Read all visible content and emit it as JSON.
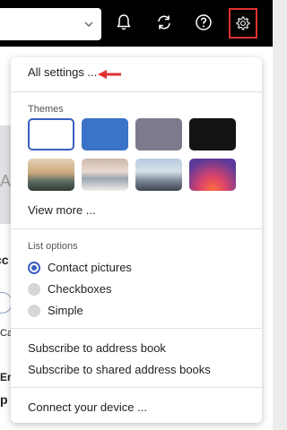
{
  "icons": {
    "chevron": "chevron-down-icon",
    "bell": "bell-icon",
    "sync": "sync-icon",
    "help": "help-icon",
    "gear": "gear-icon"
  },
  "colors": {
    "topbar": "#000000",
    "highlight": "#e03131",
    "accent": "#3a5fbf"
  },
  "menu": {
    "all_settings": "All settings ...",
    "themes_label": "Themes",
    "themes": [
      {
        "name": "white",
        "color": "#ffffff",
        "selected": true
      },
      {
        "name": "blue",
        "color": "#3a73c7"
      },
      {
        "name": "gray",
        "color": "#7b7b8c"
      },
      {
        "name": "black",
        "color": "#131313"
      },
      {
        "name": "landscape"
      },
      {
        "name": "beach"
      },
      {
        "name": "city"
      },
      {
        "name": "glow"
      }
    ],
    "view_more": "View more ...",
    "list_options_label": "List options",
    "options": [
      {
        "label": "Contact pictures",
        "selected": true
      },
      {
        "label": "Checkboxes",
        "selected": false
      },
      {
        "label": "Simple",
        "selected": false
      }
    ],
    "subscribe_address_book": "Subscribe to address book",
    "subscribe_shared": "Subscribe to shared address books",
    "connect_device": "Connect your device ..."
  },
  "background": {
    "glyph_a": "A",
    "glyph_co": "cc",
    "glyph_ca": "Ca",
    "glyph_er": "Er",
    "glyph_p": "p"
  }
}
